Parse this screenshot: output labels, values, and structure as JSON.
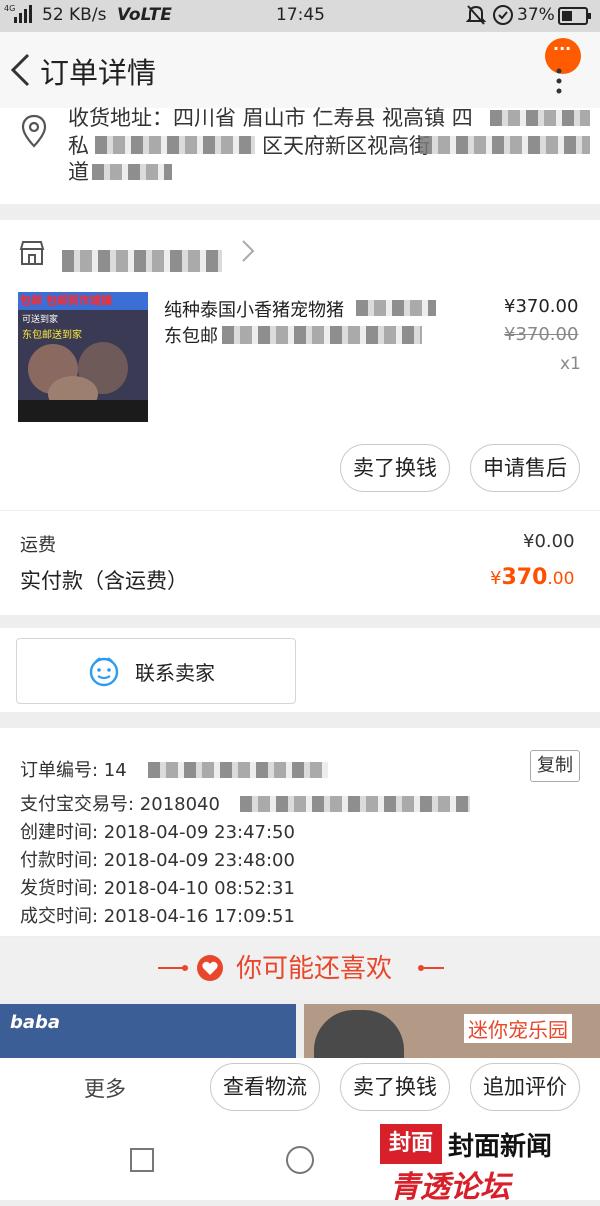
{
  "status_bar": {
    "signal": "4G",
    "speed": "52 KB/s",
    "network": "VoLTE",
    "time": "17:45",
    "battery": "37%"
  },
  "header": {
    "title": "订单详情",
    "menu_label": "···"
  },
  "address": {
    "line1": "收货地址：四川省 眉山市 仁寿县 视高镇 四",
    "line2": "私",
    "line2b": "区天府新区视高街",
    "line3": "道"
  },
  "product": {
    "thumb_text_1": "包邮 包邮到市城镇",
    "thumb_text_2": "可送到家",
    "thumb_text_3": "东包邮送到家",
    "title_1": "纯种泰国小香猪宠物猪",
    "title_2": "东包邮",
    "price": "¥370.00",
    "original_price": "¥370.00",
    "quantity": "x1",
    "sell_button": "卖了换钱",
    "after_sale_button": "申请售后"
  },
  "fees": {
    "shipping_label": "运费",
    "shipping_value": "¥0.00",
    "paid_label": "实付款（含运费）",
    "paid_currency": "¥",
    "paid_int": "370",
    "paid_dec": ".00"
  },
  "contact": {
    "label": "联系卖家"
  },
  "order_info": {
    "order_no_label": "订单编号: 14",
    "copy_button": "复制",
    "alipay_label": "支付宝交易号: 2018040",
    "created": "创建时间:  2018-04-09 23:47:50",
    "paid": "付款时间:  2018-04-09 23:48:00",
    "shipped": "发货时间:  2018-04-10 08:52:31",
    "completed": "成交时间:  2018-04-16 17:09:51"
  },
  "recommend": {
    "title": "你可能还喜欢",
    "left_tag": "baba",
    "right_tag": "迷你宠乐园"
  },
  "bottom_bar": {
    "more": "更多",
    "logistics": "查看物流",
    "sell": "卖了换钱",
    "review": "追加评价"
  },
  "watermark": {
    "logo_char": "封面",
    "brand": "封面新闻",
    "sub": "青透论坛"
  },
  "colors": {
    "accent": "#ff5b00",
    "price_orange": "#ff5000",
    "recommend_red": "#e8472b"
  }
}
